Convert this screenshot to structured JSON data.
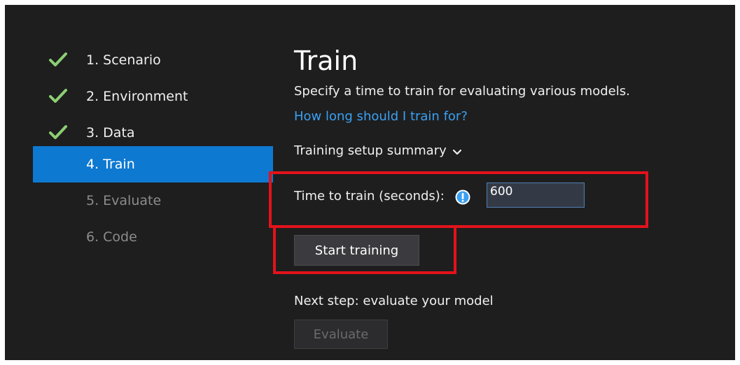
{
  "sidebar": {
    "steps": [
      {
        "label": "1. Scenario",
        "state": "completed",
        "icon": "check-icon"
      },
      {
        "label": "2. Environment",
        "state": "completed",
        "icon": "check-icon"
      },
      {
        "label": "3. Data",
        "state": "completed",
        "icon": "check-icon"
      },
      {
        "label": "4. Train",
        "state": "active"
      },
      {
        "label": "5. Evaluate",
        "state": "disabled"
      },
      {
        "label": "6. Code",
        "state": "disabled"
      }
    ]
  },
  "main": {
    "title": "Train",
    "description": "Specify a time to train for evaluating various models.",
    "help_link": "How long should I train for?",
    "summary_label": "Training setup summary",
    "summary_icon": "chevron-down-icon",
    "time_label": "Time to train (seconds):",
    "time_info_icon": "info-icon",
    "time_value": "600",
    "start_button": "Start training",
    "next_step": "Next step: evaluate your model",
    "evaluate_button": "Evaluate"
  },
  "colors": {
    "background": "#1e1e1e",
    "accent": "#0e79d1",
    "link": "#3aa0f3",
    "check": "#8ccf74",
    "highlight": "#e4121b"
  }
}
